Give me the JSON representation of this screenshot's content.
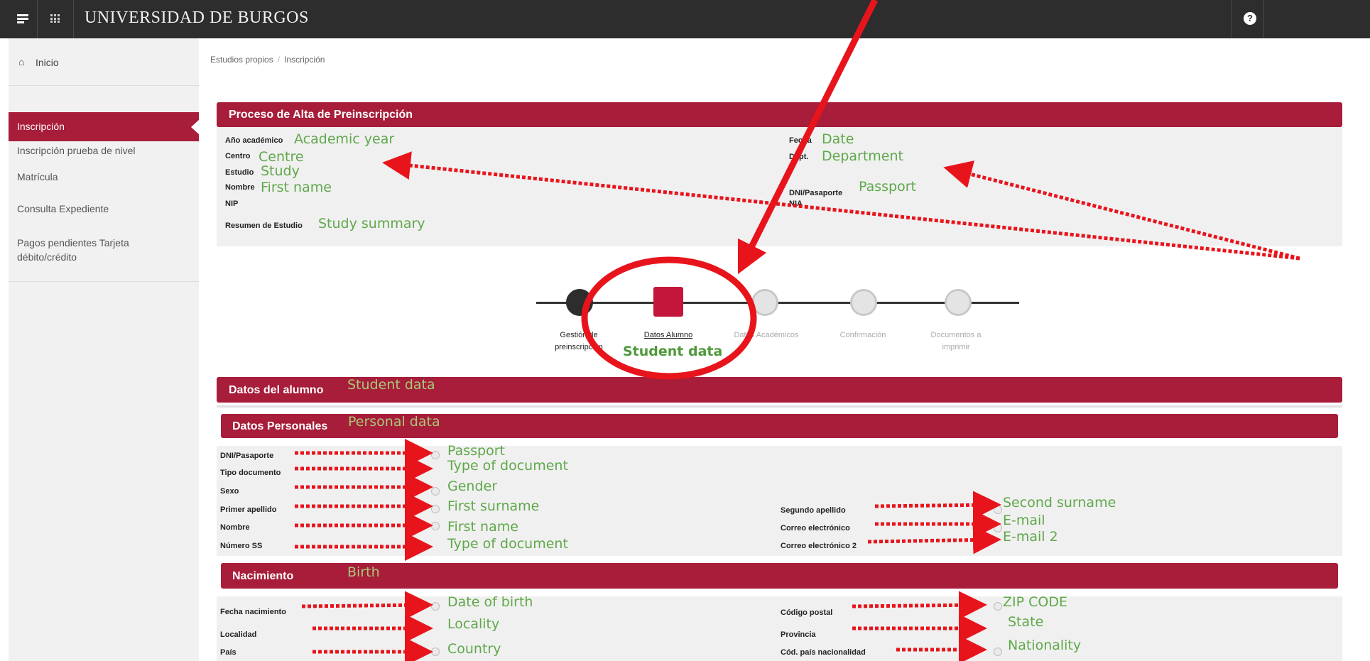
{
  "topbar": {
    "title": "UNIVERSIDAD DE BURGOS",
    "help": "?"
  },
  "sidebar": {
    "home": "Inicio",
    "items": [
      "Inscripción",
      "Inscripción prueba de nivel",
      "Matrícula",
      "Consulta Expediente",
      "Pagos pendientes Tarjeta débito/crédito"
    ],
    "active": "Inscripción"
  },
  "breadcrumb": {
    "first": "Estudios propios",
    "second": "Inscripción"
  },
  "process": {
    "title": "Proceso de Alta de Preinscripción",
    "fields": {
      "academic_year": {
        "label": "Año académico",
        "note": "Academic year"
      },
      "centre": {
        "label": "Centro",
        "note": "Centre"
      },
      "study": {
        "label": "Estudio",
        "note": "Study"
      },
      "name": {
        "label": "Nombre",
        "note": "First name"
      },
      "nip": {
        "label": "NIP"
      },
      "summary": {
        "label": "Resumen de Estudio",
        "note": "Study summary"
      },
      "date": {
        "label": "Fecha",
        "note": "Date"
      },
      "dept": {
        "label": "Dept.",
        "note": "Department"
      },
      "dni": {
        "label": "DNI/Pasaporte",
        "note": "Passport"
      },
      "nia": {
        "label": "NIA"
      }
    }
  },
  "steps": [
    {
      "label": "Gestión de preinscripción",
      "state": "done"
    },
    {
      "label": "Datos Alumno",
      "state": "current",
      "note": "Student data"
    },
    {
      "label": "Datos Académicos",
      "state": "pending"
    },
    {
      "label": "Confirmación",
      "state": "pending"
    },
    {
      "label": "Documentos a imprimir",
      "state": "pending"
    }
  ],
  "student": {
    "title": "Datos del alumno",
    "note": "Student data"
  },
  "personal": {
    "title": "Datos Personales",
    "note": "Personal data",
    "left": [
      {
        "label": "DNI/Pasaporte",
        "note": "Passport"
      },
      {
        "label": "Tipo documento",
        "note": "Type of document"
      },
      {
        "label": "Sexo",
        "note": "Gender"
      },
      {
        "label": "Primer apellido",
        "note": "First surname"
      },
      {
        "label": "Nombre",
        "note": "First name"
      },
      {
        "label": "Número SS",
        "note": "Type of document"
      }
    ],
    "right": [
      {
        "label": "Segundo apellido",
        "note": "Second surname"
      },
      {
        "label": "Correo electrónico",
        "note": "E-mail"
      },
      {
        "label": "Correo electrónico 2",
        "note": "E-mail 2"
      }
    ]
  },
  "birth": {
    "title": "Nacimiento",
    "note": "Birth",
    "left": [
      {
        "label": "Fecha nacimiento",
        "note": "Date of birth"
      },
      {
        "label": "Localidad",
        "note": "Locality"
      },
      {
        "label": "País",
        "note": "Country"
      }
    ],
    "right": [
      {
        "label": "Código postal",
        "note": "ZIP CODE"
      },
      {
        "label": "Provincia",
        "note": "State"
      },
      {
        "label": "Cód. país nacionalidad",
        "note": "Nationality"
      }
    ]
  },
  "colors": {
    "brand": "#a71d3a",
    "annotation": "#5fa84a",
    "arrow": "#e8141c"
  }
}
